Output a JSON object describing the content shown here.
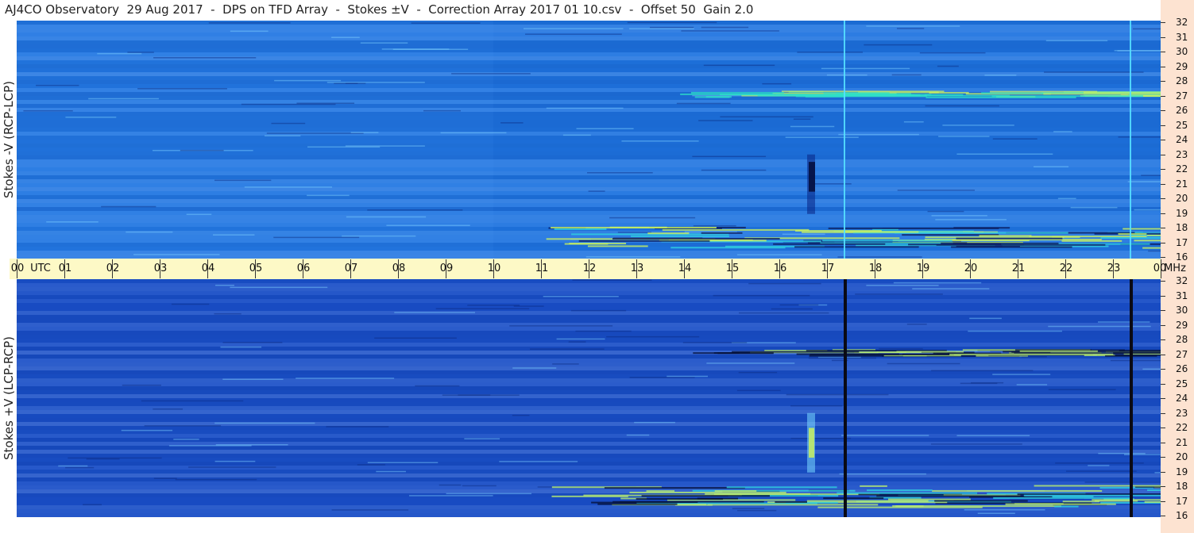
{
  "title": "AJ4CO Observatory  29 Aug 2017  -  DPS on TFD Array  -  Stokes ±V  -  Correction Array 2017 01 10.csv  -  Offset 50  Gain 2.0",
  "chart_data": [
    {
      "type": "heatmap",
      "name": "top-panel",
      "ylabel": "Stokes -V (RCP-LCP)",
      "y_ticks": [
        "32",
        "31",
        "30",
        "29",
        "28",
        "27",
        "26",
        "25",
        "24",
        "23",
        "22",
        "21",
        "20",
        "19",
        "18",
        "17",
        "16"
      ],
      "ylim": [
        16,
        32
      ],
      "xlim": [
        0,
        24
      ],
      "colors": {
        "background": "#1f74e0",
        "bright": "#c8f060",
        "dark": "#0c1e60"
      }
    },
    {
      "type": "heatmap",
      "name": "bottom-panel",
      "ylabel": "Stokes +V (LCP-RCP)",
      "y_ticks": [
        "32",
        "31",
        "30",
        "29",
        "28",
        "27",
        "26",
        "25",
        "24",
        "23",
        "22",
        "21",
        "20",
        "19",
        "18",
        "17",
        "16"
      ],
      "ylim": [
        16,
        32
      ],
      "xlim": [
        0,
        24
      ],
      "colors": {
        "background": "#1a4fc7",
        "bright": "#c8f060",
        "dark": "#06123a"
      }
    }
  ],
  "time_axis": {
    "labels": [
      "00",
      "01",
      "02",
      "03",
      "04",
      "05",
      "06",
      "07",
      "08",
      "09",
      "10",
      "11",
      "12",
      "13",
      "14",
      "15",
      "16",
      "17",
      "18",
      "19",
      "20",
      "21",
      "22",
      "23",
      "00"
    ],
    "utc_label": "UTC",
    "unit_label": "MHz"
  }
}
